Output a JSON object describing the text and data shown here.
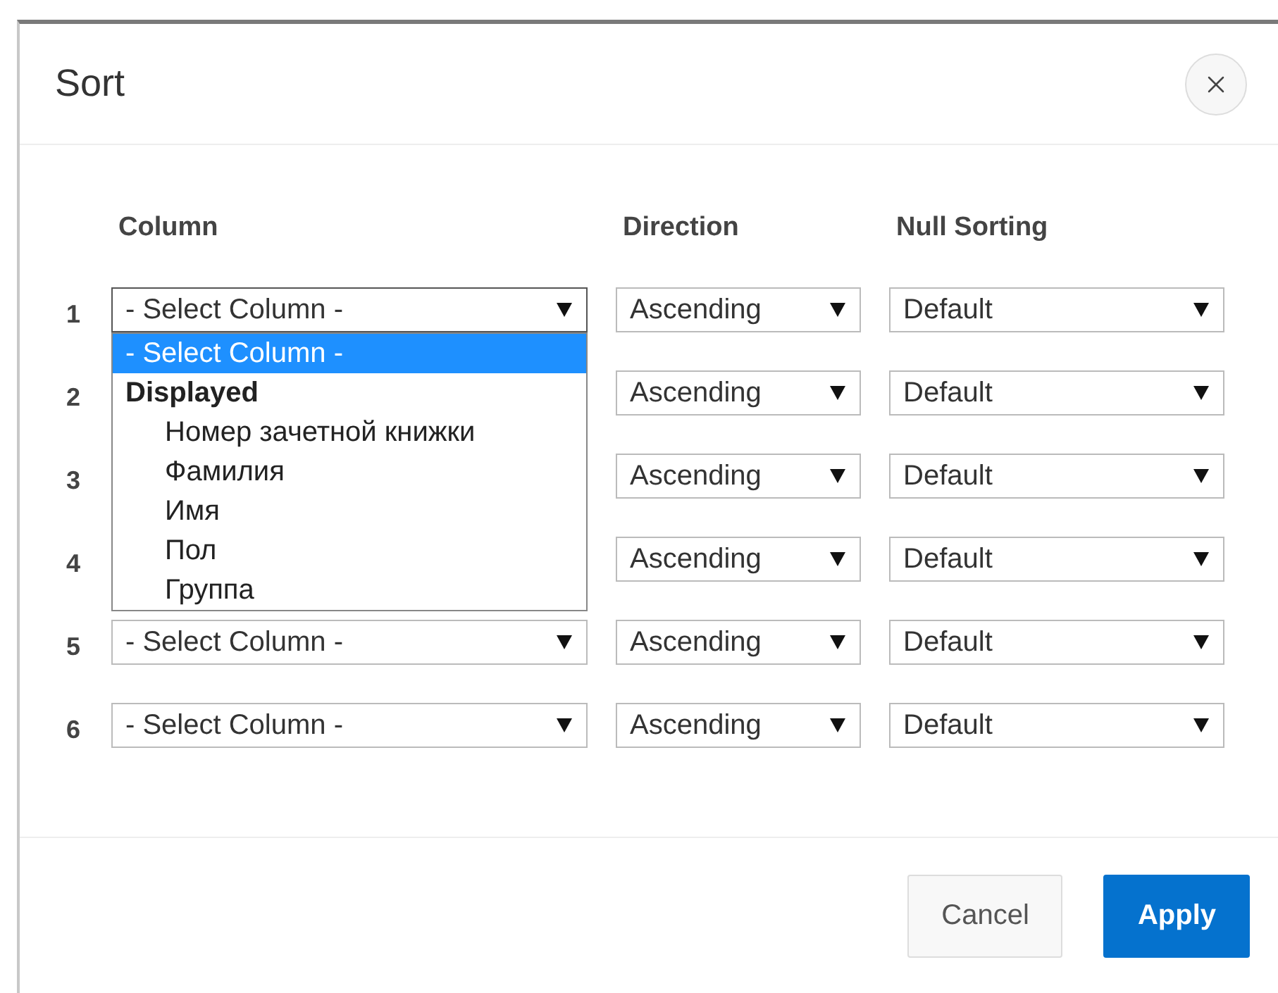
{
  "dialog": {
    "title": "Sort"
  },
  "headers": [
    "Column",
    "Direction",
    "Null Sorting"
  ],
  "rows": [
    {
      "number": "1",
      "column": "- Select Column -",
      "direction": "Ascending",
      "null_sorting": "Default",
      "expanded": true
    },
    {
      "number": "2",
      "direction": "Ascending",
      "null_sorting": "Default",
      "expanded": false
    },
    {
      "number": "3",
      "direction": "Ascending",
      "null_sorting": "Default",
      "expanded": false
    },
    {
      "number": "4",
      "direction": "Ascending",
      "null_sorting": "Default",
      "expanded": false
    },
    {
      "number": "5",
      "column": "- Select Column -",
      "direction": "Ascending",
      "null_sorting": "Default",
      "expanded": false
    },
    {
      "number": "6",
      "column": "- Select Column -",
      "direction": "Ascending",
      "null_sorting": "Default",
      "expanded": false
    }
  ],
  "dropdown": {
    "options": [
      {
        "kind": "option",
        "label": "- Select Column -",
        "selected": true
      },
      {
        "kind": "group",
        "label": "Displayed",
        "children": [
          {
            "kind": "option",
            "label": "Номер зачетной книжки",
            "selected": false
          },
          {
            "kind": "option",
            "label": "Фамилия",
            "selected": false
          },
          {
            "kind": "option",
            "label": "Имя",
            "selected": false
          },
          {
            "kind": "option",
            "label": "Пол",
            "selected": false
          },
          {
            "kind": "option",
            "label": "Группа",
            "selected": false
          }
        ]
      }
    ]
  },
  "buttons": [
    {
      "kind": "secondary",
      "label": "Cancel"
    },
    {
      "kind": "primary",
      "label": "Apply"
    }
  ]
}
